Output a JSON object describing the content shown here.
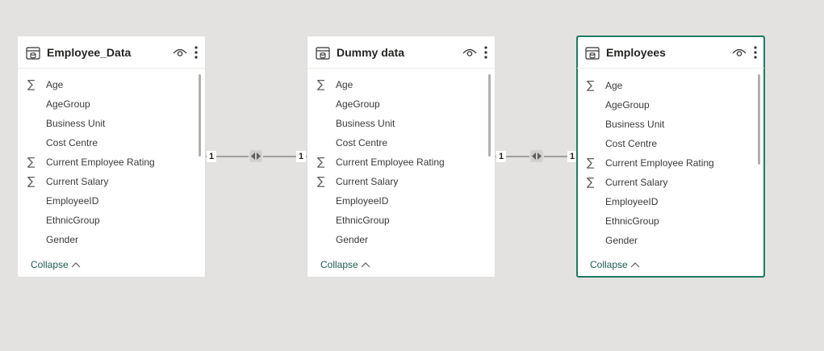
{
  "tables": [
    {
      "title": "Employee_Data",
      "fields": [
        {
          "name": "Age",
          "sigma": true
        },
        {
          "name": "AgeGroup",
          "sigma": false
        },
        {
          "name": "Business Unit",
          "sigma": false
        },
        {
          "name": "Cost Centre",
          "sigma": false
        },
        {
          "name": "Current Employee Rating",
          "sigma": true
        },
        {
          "name": "Current Salary",
          "sigma": true
        },
        {
          "name": "EmployeeID",
          "sigma": false
        },
        {
          "name": "EthnicGroup",
          "sigma": false
        },
        {
          "name": "Gender",
          "sigma": false
        }
      ],
      "collapse_label": "Collapse",
      "selected": false
    },
    {
      "title": "Dummy data",
      "fields": [
        {
          "name": "Age",
          "sigma": true
        },
        {
          "name": "AgeGroup",
          "sigma": false
        },
        {
          "name": "Business Unit",
          "sigma": false
        },
        {
          "name": "Cost Centre",
          "sigma": false
        },
        {
          "name": "Current Employee Rating",
          "sigma": true
        },
        {
          "name": "Current Salary",
          "sigma": true
        },
        {
          "name": "EmployeeID",
          "sigma": false
        },
        {
          "name": "EthnicGroup",
          "sigma": false
        },
        {
          "name": "Gender",
          "sigma": false
        }
      ],
      "collapse_label": "Collapse",
      "selected": false
    },
    {
      "title": "Employees",
      "fields": [
        {
          "name": "Age",
          "sigma": true
        },
        {
          "name": "AgeGroup",
          "sigma": false
        },
        {
          "name": "Business Unit",
          "sigma": false
        },
        {
          "name": "Cost Centre",
          "sigma": false
        },
        {
          "name": "Current Employee Rating",
          "sigma": true
        },
        {
          "name": "Current Salary",
          "sigma": true
        },
        {
          "name": "EmployeeID",
          "sigma": false
        },
        {
          "name": "EthnicGroup",
          "sigma": false
        },
        {
          "name": "Gender",
          "sigma": false
        }
      ],
      "collapse_label": "Collapse",
      "selected": true
    }
  ],
  "relationships": [
    {
      "from_cardinality": "1",
      "to_cardinality": "1",
      "direction": "both"
    },
    {
      "from_cardinality": "1",
      "to_cardinality": "1",
      "direction": "both"
    }
  ],
  "icons": {
    "sigma": "∑",
    "table": "table-icon",
    "visibility": "eye-icon",
    "more": "more-options-icon",
    "collapse": "chevron-up-icon",
    "direction": "bidirectional-filter-icon"
  },
  "colors": {
    "canvas": "#e4e2e0",
    "selected_border": "#1d7c63",
    "collapse_text": "#1f5c52"
  }
}
